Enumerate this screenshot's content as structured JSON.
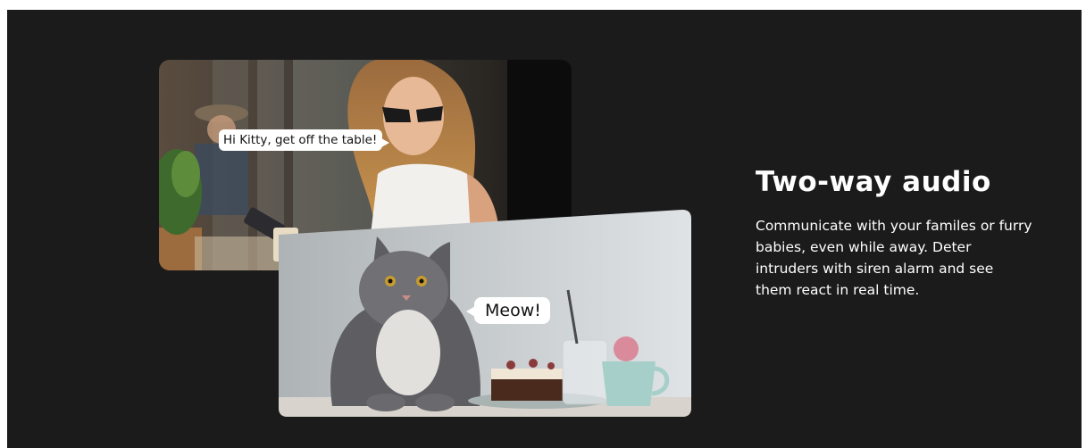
{
  "feature": {
    "title": "Two-way audio",
    "description": "Communicate with your familes or furry babies, even while away. Deter intruders with siren alarm and see them react in real time."
  },
  "scenes": {
    "woman": {
      "speech": "Hi Kitty, get off the table!"
    },
    "cat": {
      "speech": "Meow!"
    }
  },
  "colors": {
    "background": "#1b1b1b",
    "text": "#ffffff",
    "bubble": "#ffffff"
  }
}
